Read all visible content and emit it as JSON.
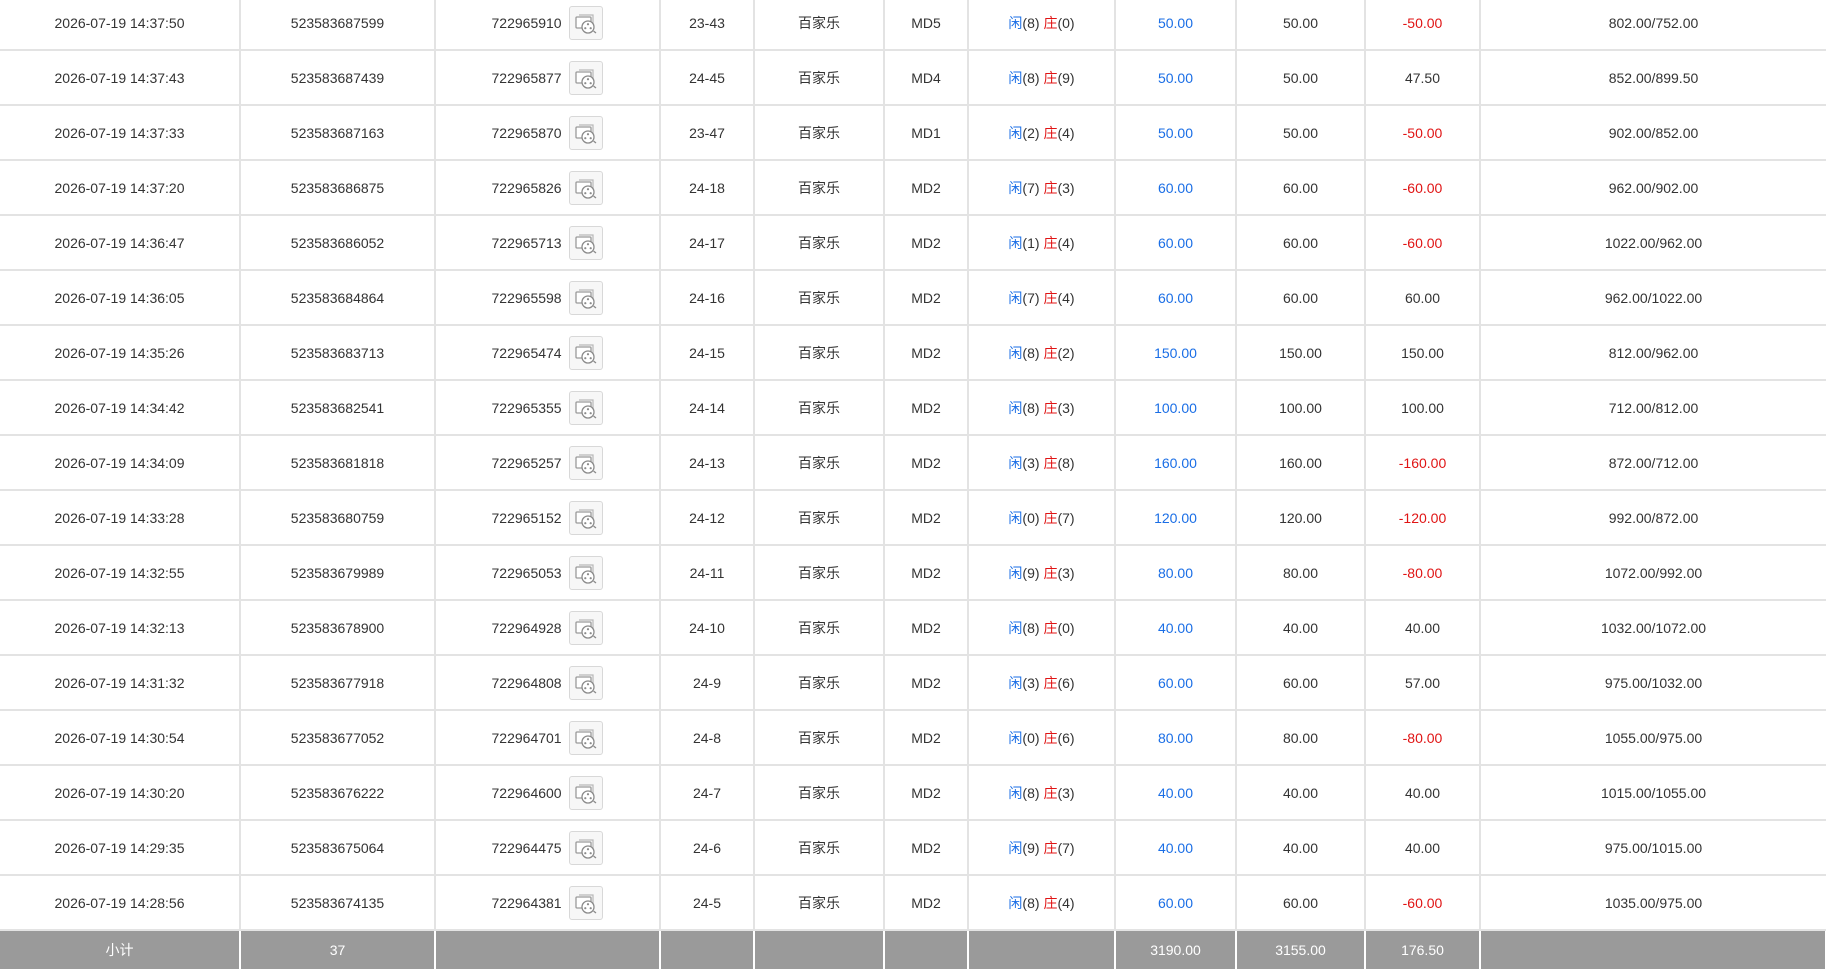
{
  "colors": {
    "player": "#1a6ee6",
    "banker": "#e01414",
    "bet_amount": "#1a6ee6",
    "loss": "#e01414",
    "subtotal_bg": "#9a9a9a",
    "grid": "#e3e3e3"
  },
  "icons": {
    "replay": "video-replay-icon"
  },
  "rows": [
    {
      "time": "2026-07-19 14:37:50",
      "bet_id": "523583687599",
      "round_id": "722965910",
      "shoe": "23-43",
      "game": "百家乐",
      "table": "MD5",
      "p_label": "闲",
      "p_score": "(8)",
      "b_label": "庄",
      "b_score": "(0)",
      "bet": "50.00",
      "valid": "50.00",
      "win": "-50.00",
      "win_negative": true,
      "balance": "802.00/752.00"
    },
    {
      "time": "2026-07-19 14:37:43",
      "bet_id": "523583687439",
      "round_id": "722965877",
      "shoe": "24-45",
      "game": "百家乐",
      "table": "MD4",
      "p_label": "闲",
      "p_score": "(8)",
      "b_label": "庄",
      "b_score": "(9)",
      "bet": "50.00",
      "valid": "50.00",
      "win": "47.50",
      "win_negative": false,
      "balance": "852.00/899.50"
    },
    {
      "time": "2026-07-19 14:37:33",
      "bet_id": "523583687163",
      "round_id": "722965870",
      "shoe": "23-47",
      "game": "百家乐",
      "table": "MD1",
      "p_label": "闲",
      "p_score": "(2)",
      "b_label": "庄",
      "b_score": "(4)",
      "bet": "50.00",
      "valid": "50.00",
      "win": "-50.00",
      "win_negative": true,
      "balance": "902.00/852.00"
    },
    {
      "time": "2026-07-19 14:37:20",
      "bet_id": "523583686875",
      "round_id": "722965826",
      "shoe": "24-18",
      "game": "百家乐",
      "table": "MD2",
      "p_label": "闲",
      "p_score": "(7)",
      "b_label": "庄",
      "b_score": "(3)",
      "bet": "60.00",
      "valid": "60.00",
      "win": "-60.00",
      "win_negative": true,
      "balance": "962.00/902.00"
    },
    {
      "time": "2026-07-19 14:36:47",
      "bet_id": "523583686052",
      "round_id": "722965713",
      "shoe": "24-17",
      "game": "百家乐",
      "table": "MD2",
      "p_label": "闲",
      "p_score": "(1)",
      "b_label": "庄",
      "b_score": "(4)",
      "bet": "60.00",
      "valid": "60.00",
      "win": "-60.00",
      "win_negative": true,
      "balance": "1022.00/962.00"
    },
    {
      "time": "2026-07-19 14:36:05",
      "bet_id": "523583684864",
      "round_id": "722965598",
      "shoe": "24-16",
      "game": "百家乐",
      "table": "MD2",
      "p_label": "闲",
      "p_score": "(7)",
      "b_label": "庄",
      "b_score": "(4)",
      "bet": "60.00",
      "valid": "60.00",
      "win": "60.00",
      "win_negative": false,
      "balance": "962.00/1022.00"
    },
    {
      "time": "2026-07-19 14:35:26",
      "bet_id": "523583683713",
      "round_id": "722965474",
      "shoe": "24-15",
      "game": "百家乐",
      "table": "MD2",
      "p_label": "闲",
      "p_score": "(8)",
      "b_label": "庄",
      "b_score": "(2)",
      "bet": "150.00",
      "valid": "150.00",
      "win": "150.00",
      "win_negative": false,
      "balance": "812.00/962.00"
    },
    {
      "time": "2026-07-19 14:34:42",
      "bet_id": "523583682541",
      "round_id": "722965355",
      "shoe": "24-14",
      "game": "百家乐",
      "table": "MD2",
      "p_label": "闲",
      "p_score": "(8)",
      "b_label": "庄",
      "b_score": "(3)",
      "bet": "100.00",
      "valid": "100.00",
      "win": "100.00",
      "win_negative": false,
      "balance": "712.00/812.00"
    },
    {
      "time": "2026-07-19 14:34:09",
      "bet_id": "523583681818",
      "round_id": "722965257",
      "shoe": "24-13",
      "game": "百家乐",
      "table": "MD2",
      "p_label": "闲",
      "p_score": "(3)",
      "b_label": "庄",
      "b_score": "(8)",
      "bet": "160.00",
      "valid": "160.00",
      "win": "-160.00",
      "win_negative": true,
      "balance": "872.00/712.00"
    },
    {
      "time": "2026-07-19 14:33:28",
      "bet_id": "523583680759",
      "round_id": "722965152",
      "shoe": "24-12",
      "game": "百家乐",
      "table": "MD2",
      "p_label": "闲",
      "p_score": "(0)",
      "b_label": "庄",
      "b_score": "(7)",
      "bet": "120.00",
      "valid": "120.00",
      "win": "-120.00",
      "win_negative": true,
      "balance": "992.00/872.00"
    },
    {
      "time": "2026-07-19 14:32:55",
      "bet_id": "523583679989",
      "round_id": "722965053",
      "shoe": "24-11",
      "game": "百家乐",
      "table": "MD2",
      "p_label": "闲",
      "p_score": "(9)",
      "b_label": "庄",
      "b_score": "(3)",
      "bet": "80.00",
      "valid": "80.00",
      "win": "-80.00",
      "win_negative": true,
      "balance": "1072.00/992.00"
    },
    {
      "time": "2026-07-19 14:32:13",
      "bet_id": "523583678900",
      "round_id": "722964928",
      "shoe": "24-10",
      "game": "百家乐",
      "table": "MD2",
      "p_label": "闲",
      "p_score": "(8)",
      "b_label": "庄",
      "b_score": "(0)",
      "bet": "40.00",
      "valid": "40.00",
      "win": "40.00",
      "win_negative": false,
      "balance": "1032.00/1072.00"
    },
    {
      "time": "2026-07-19 14:31:32",
      "bet_id": "523583677918",
      "round_id": "722964808",
      "shoe": "24-9",
      "game": "百家乐",
      "table": "MD2",
      "p_label": "闲",
      "p_score": "(3)",
      "b_label": "庄",
      "b_score": "(6)",
      "bet": "60.00",
      "valid": "60.00",
      "win": "57.00",
      "win_negative": false,
      "balance": "975.00/1032.00"
    },
    {
      "time": "2026-07-19 14:30:54",
      "bet_id": "523583677052",
      "round_id": "722964701",
      "shoe": "24-8",
      "game": "百家乐",
      "table": "MD2",
      "p_label": "闲",
      "p_score": "(0)",
      "b_label": "庄",
      "b_score": "(6)",
      "bet": "80.00",
      "valid": "80.00",
      "win": "-80.00",
      "win_negative": true,
      "balance": "1055.00/975.00"
    },
    {
      "time": "2026-07-19 14:30:20",
      "bet_id": "523583676222",
      "round_id": "722964600",
      "shoe": "24-7",
      "game": "百家乐",
      "table": "MD2",
      "p_label": "闲",
      "p_score": "(8)",
      "b_label": "庄",
      "b_score": "(3)",
      "bet": "40.00",
      "valid": "40.00",
      "win": "40.00",
      "win_negative": false,
      "balance": "1015.00/1055.00"
    },
    {
      "time": "2026-07-19 14:29:35",
      "bet_id": "523583675064",
      "round_id": "722964475",
      "shoe": "24-6",
      "game": "百家乐",
      "table": "MD2",
      "p_label": "闲",
      "p_score": "(9)",
      "b_label": "庄",
      "b_score": "(7)",
      "bet": "40.00",
      "valid": "40.00",
      "win": "40.00",
      "win_negative": false,
      "balance": "975.00/1015.00"
    },
    {
      "time": "2026-07-19 14:28:56",
      "bet_id": "523583674135",
      "round_id": "722964381",
      "shoe": "24-5",
      "game": "百家乐",
      "table": "MD2",
      "p_label": "闲",
      "p_score": "(8)",
      "b_label": "庄",
      "b_score": "(4)",
      "bet": "60.00",
      "valid": "60.00",
      "win": "-60.00",
      "win_negative": true,
      "balance": "1035.00/975.00"
    }
  ],
  "subtotal": {
    "label": "小计",
    "count": "37",
    "bet_total": "3190.00",
    "valid_total": "3155.00",
    "win_total": "176.50"
  }
}
